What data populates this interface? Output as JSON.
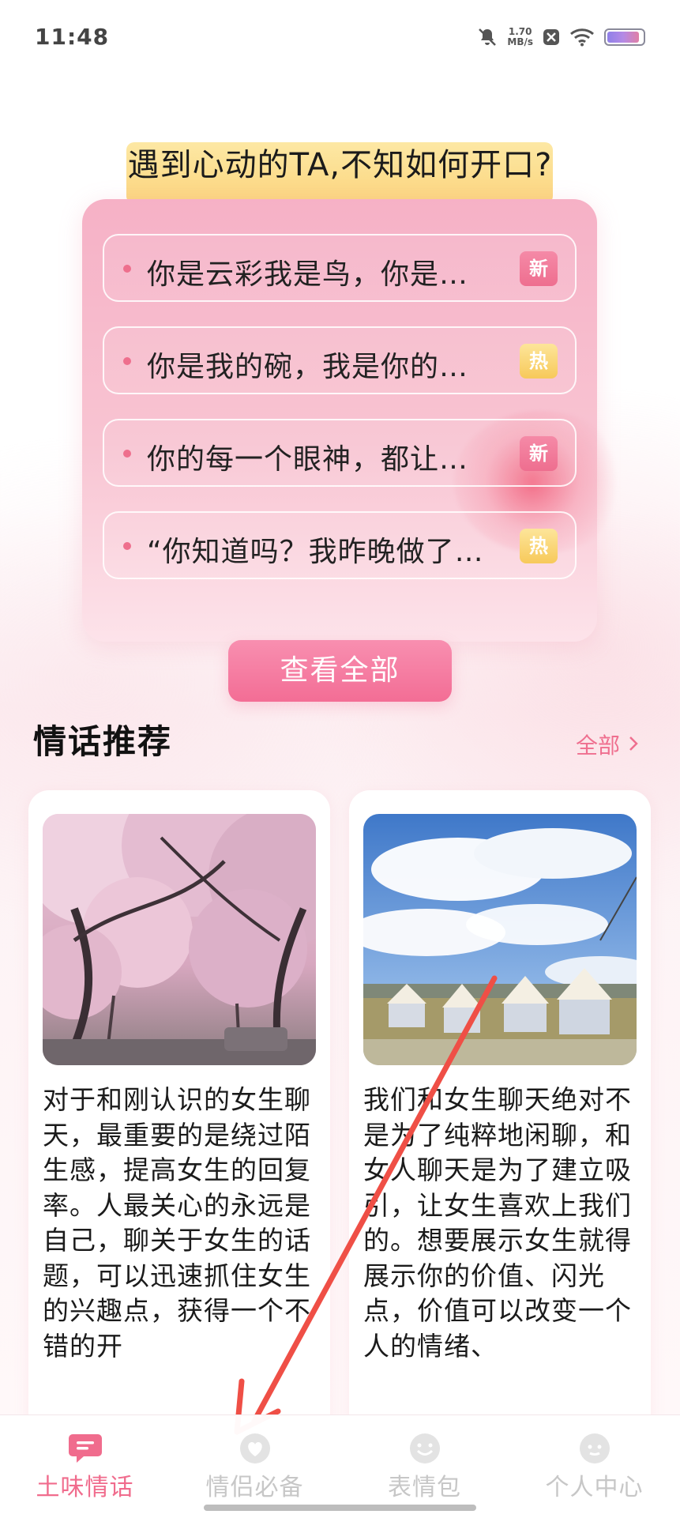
{
  "status_bar": {
    "time": "11:48",
    "net_speed_value": "1.70",
    "net_speed_unit": "MB/s",
    "icons": [
      "notifications-muted-icon",
      "x-app-icon",
      "wifi-icon",
      "battery-icon"
    ],
    "battery_level": 0.9
  },
  "hero": {
    "title": "遇到心动的TA,不知如何开口?",
    "lines": [
      {
        "text": "你是云彩我是鸟，你是…",
        "badge": "新",
        "badge_type": "new"
      },
      {
        "text": "你是我的碗，我是你的…",
        "badge": "热",
        "badge_type": "hot"
      },
      {
        "text": "你的每一个眼神，都让…",
        "badge": "新",
        "badge_type": "new"
      },
      {
        "text": "“你知道吗？我昨晚做了…",
        "badge": "热",
        "badge_type": "hot"
      }
    ],
    "view_all_label": "查看全部"
  },
  "recommend": {
    "title": "情话推荐",
    "more_label": "全部",
    "articles": [
      {
        "image": "cherry-blossom-tree-photo",
        "text": "对于和刚认识的女生聊天，最重要的是绕过陌生感，提高女生的回复率。人最关心的永远是自己，聊关于女生的话题，可以迅速抓住女生的兴趣点，获得一个不错的开"
      },
      {
        "image": "sky-and-tents-photo",
        "text": "我们和女生聊天绝对不是为了纯粹地闲聊，和女人聊天是为了建立吸引，让女生喜欢上我们的。想要展示女生就得展示你的价值、闪光点，价值可以改变一个人的情绪、"
      }
    ]
  },
  "tabs": [
    {
      "label": "土味情话",
      "icon": "chat-bubble-icon",
      "active": true
    },
    {
      "label": "情侣必备",
      "icon": "heart-icon",
      "active": false
    },
    {
      "label": "表情包",
      "icon": "smile-face-icon",
      "active": false
    },
    {
      "label": "个人中心",
      "icon": "user-face-icon",
      "active": false
    }
  ],
  "colors": {
    "accent": "#f06c8d",
    "card_pink": "#f6b1c6",
    "badge_hot": "#f7c95a",
    "annotation_red": "#ef4f46"
  }
}
